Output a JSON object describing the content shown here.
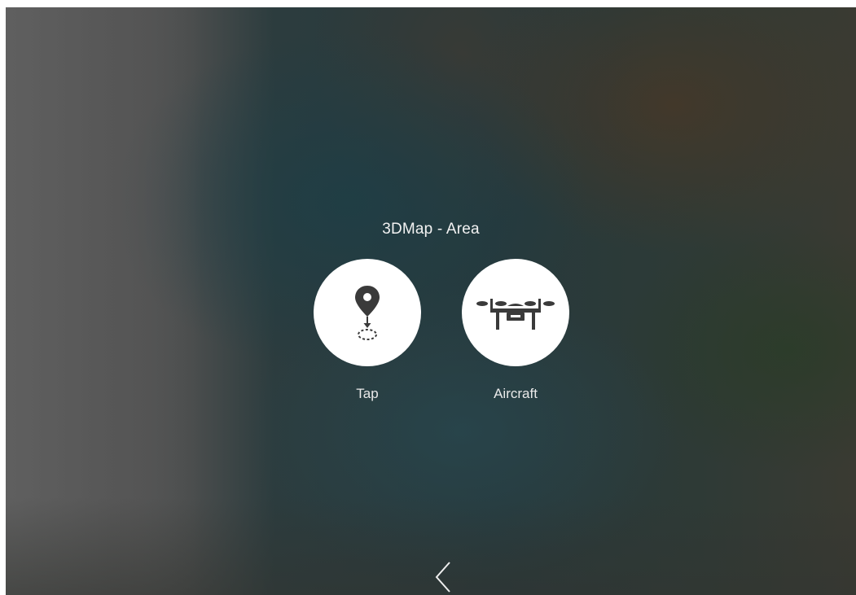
{
  "dialog": {
    "title": "3DMap - Area"
  },
  "options": [
    {
      "label": "Tap",
      "icon": "map-pin-tap-icon"
    },
    {
      "label": "Aircraft",
      "icon": "drone-icon"
    }
  ],
  "navigation": {
    "back_icon": "chevron-left-icon"
  },
  "colors": {
    "circle": "#ffffff",
    "icon": "#3a3a3a",
    "text": "#f2f2f2"
  }
}
